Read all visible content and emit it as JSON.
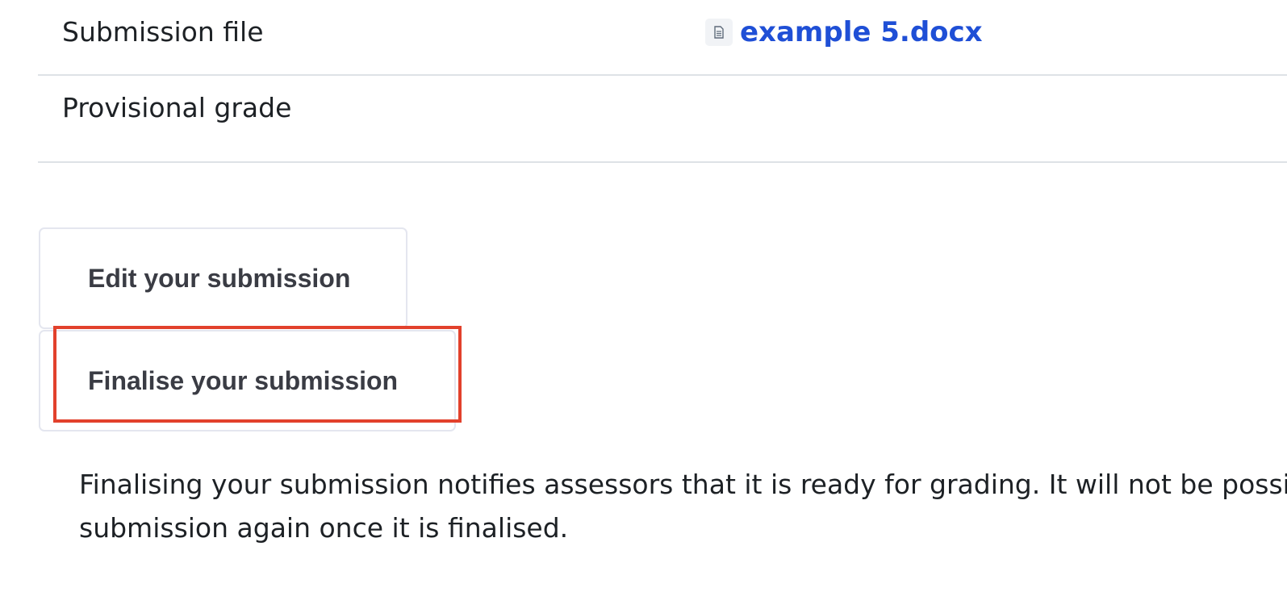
{
  "status_table": {
    "rows": [
      {
        "label": "Submission file",
        "file_name": "example 5.docx",
        "file_icon": "document-icon"
      },
      {
        "label": "Provisional grade",
        "value": ""
      }
    ]
  },
  "actions": {
    "edit_label": "Edit your submission",
    "finalise_label": "Finalise your submission"
  },
  "finalise_note": {
    "line1": "Finalising your submission notifies assessors that it is ready for grading. It will not be possibl",
    "line2": "submission again once it is finalised."
  },
  "colors": {
    "link": "#1f4fd6",
    "highlight": "#e2412c",
    "divider": "#dee2e6"
  }
}
